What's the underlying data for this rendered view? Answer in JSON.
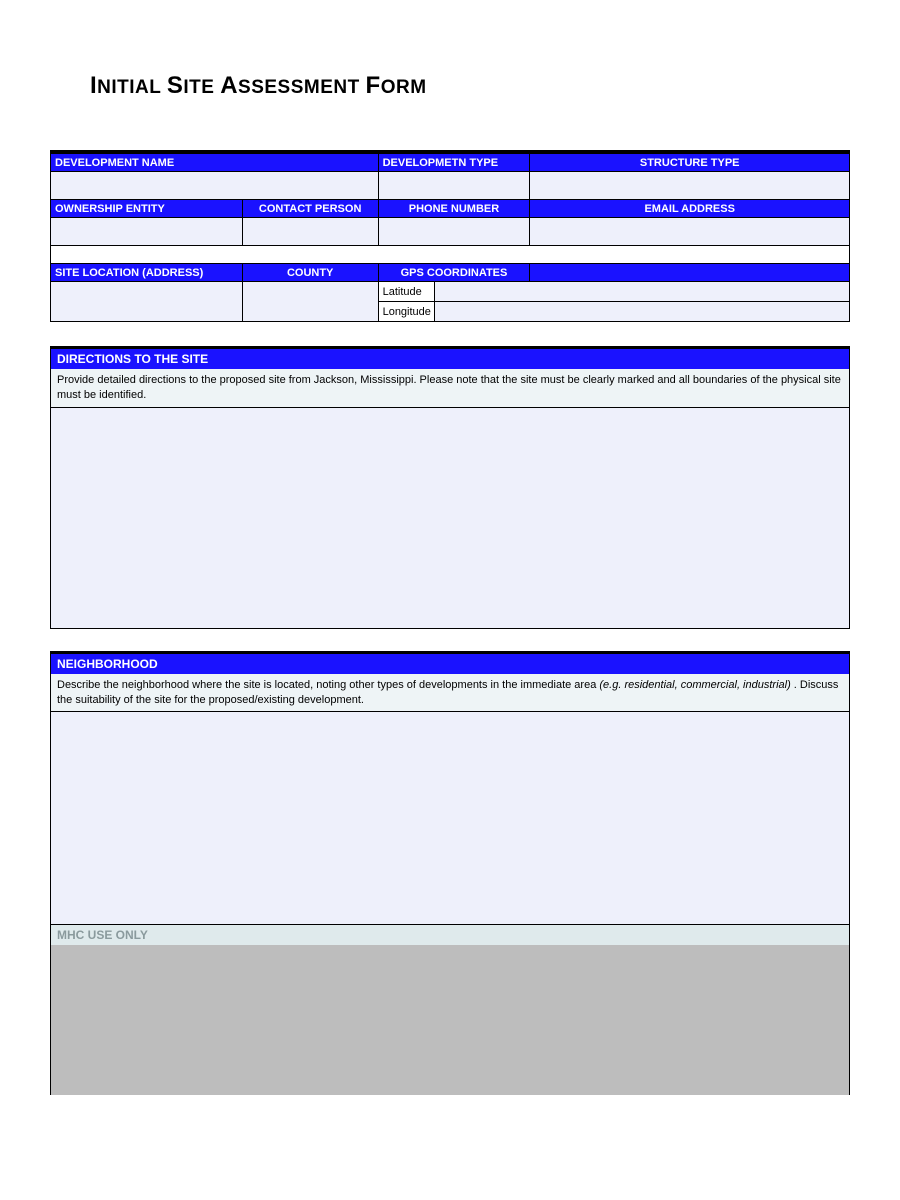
{
  "title_parts": {
    "t1a": "I",
    "t1b": "NITIAL ",
    "t2a": "S",
    "t2b": "ITE ",
    "t3a": "A",
    "t3b": "SSESSMENT ",
    "t4a": "F",
    "t4b": "ORM"
  },
  "headers": {
    "dev_name": "DEVELOPMENT NAME",
    "dev_type": "DEVELOPMETN TYPE",
    "struct_type": "STRUCTURE TYPE",
    "ownership": "OWNERSHIP ENTITY",
    "contact": "CONTACT PERSON",
    "phone": "PHONE NUMBER",
    "email": "EMAIL ADDRESS",
    "site_loc": "SITE LOCATION (ADDRESS)",
    "county": "COUNTY",
    "gps": "GPS COORDINATES"
  },
  "gps": {
    "lat_label": "Latitude",
    "lon_label": "Longitude"
  },
  "values": {
    "dev_name": "",
    "dev_type": "",
    "struct_type": "",
    "ownership": "",
    "contact": "",
    "phone": "",
    "email": "",
    "site_loc": "",
    "county": "",
    "lat": "",
    "lon": ""
  },
  "directions": {
    "header": "DIRECTIONS TO THE SITE",
    "instructions": "Provide detailed directions to the proposed site from Jackson, Mississippi.  Please note that the site must be clearly marked and all boundaries of the physical site must be identified.",
    "value": ""
  },
  "neighborhood": {
    "header": "NEIGHBORHOOD",
    "instructions_pre": "Describe the neighborhood where the site is located, noting other types of developments in the immediate area ",
    "instructions_ital": "(e.g. residential, commercial, industrial)",
    "instructions_post": " .  Discuss the suitability of the site for the proposed/existing development.",
    "value": ""
  },
  "mhc": {
    "header": "MHC USE ONLY"
  }
}
